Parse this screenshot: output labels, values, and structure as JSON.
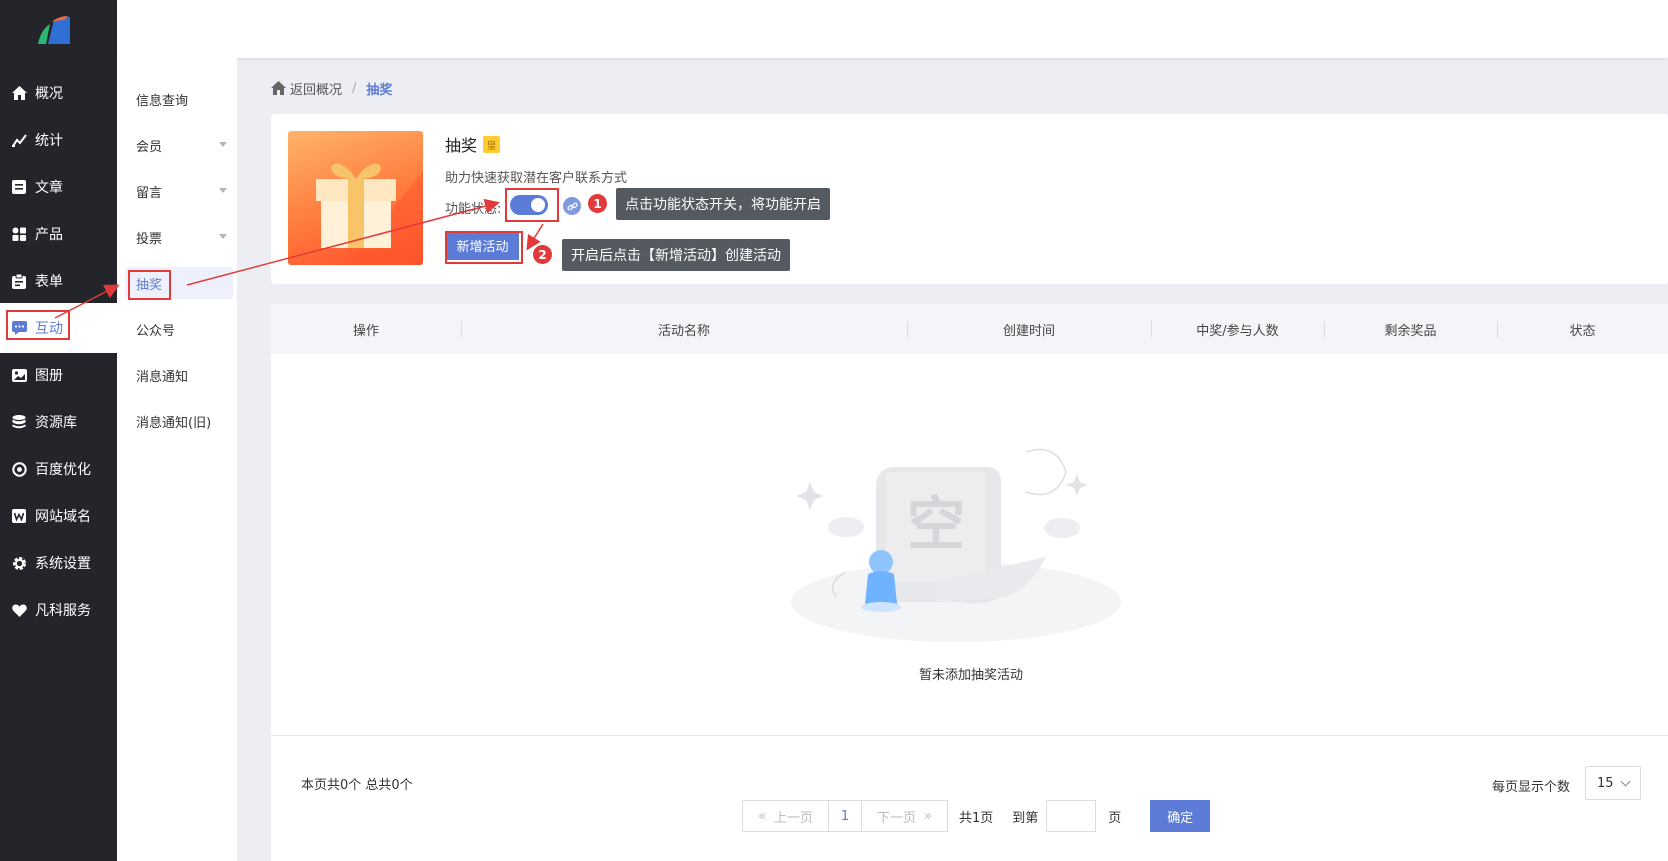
{
  "sidebar": {
    "items": [
      {
        "label": "概况",
        "icon": "home-icon"
      },
      {
        "label": "统计",
        "icon": "chart-icon"
      },
      {
        "label": "文章",
        "icon": "article-icon"
      },
      {
        "label": "产品",
        "icon": "grid-icon"
      },
      {
        "label": "表单",
        "icon": "clipboard-icon"
      },
      {
        "label": "互动",
        "icon": "chat-icon"
      },
      {
        "label": "图册",
        "icon": "album-icon"
      },
      {
        "label": "资源库",
        "icon": "database-icon"
      },
      {
        "label": "百度优化",
        "icon": "target-icon"
      },
      {
        "label": "网站域名",
        "icon": "w-icon"
      },
      {
        "label": "系统设置",
        "icon": "gear-icon"
      },
      {
        "label": "凡科服务",
        "icon": "heart-icon"
      }
    ]
  },
  "submenu": {
    "items": [
      {
        "label": "信息查询"
      },
      {
        "label": "会员"
      },
      {
        "label": "留言"
      },
      {
        "label": "投票"
      },
      {
        "label": "抽奖"
      },
      {
        "label": "公众号"
      },
      {
        "label": "消息通知"
      },
      {
        "label": "消息通知(旧)"
      }
    ]
  },
  "breadcrumb": {
    "back": "返回概况",
    "sep": "/",
    "current": "抽奖"
  },
  "card": {
    "title": "抽奖",
    "badge": "皇",
    "desc": "助力快速获取潜在客户联系方式",
    "status_label": "功能状态:",
    "new_button": "新增活动"
  },
  "tips": {
    "step1": "1",
    "tip1": "点击功能状态开关，将功能开启",
    "step2": "2",
    "tip2": "开启后点击【新增活动】创建活动"
  },
  "table": {
    "headers": [
      "操作",
      "活动名称",
      "创建时间",
      "中奖/参与人数",
      "剩余奖品",
      "状态"
    ],
    "empty_text": "暂未添加抽奖活动",
    "empty_glyph": "空"
  },
  "footer": {
    "count": "本页共0个  总共0个",
    "per_page_label": "每页显示个数",
    "per_page_value": "15",
    "prev": "上一页",
    "page": "1",
    "next": "下一页",
    "total": "共1页",
    "goto": "到第",
    "page_unit": "页",
    "confirm": "确定"
  },
  "colors": {
    "accent": "#5b7bd6",
    "sidebar_bg": "#23252b",
    "highlight": "#e23a3a"
  }
}
